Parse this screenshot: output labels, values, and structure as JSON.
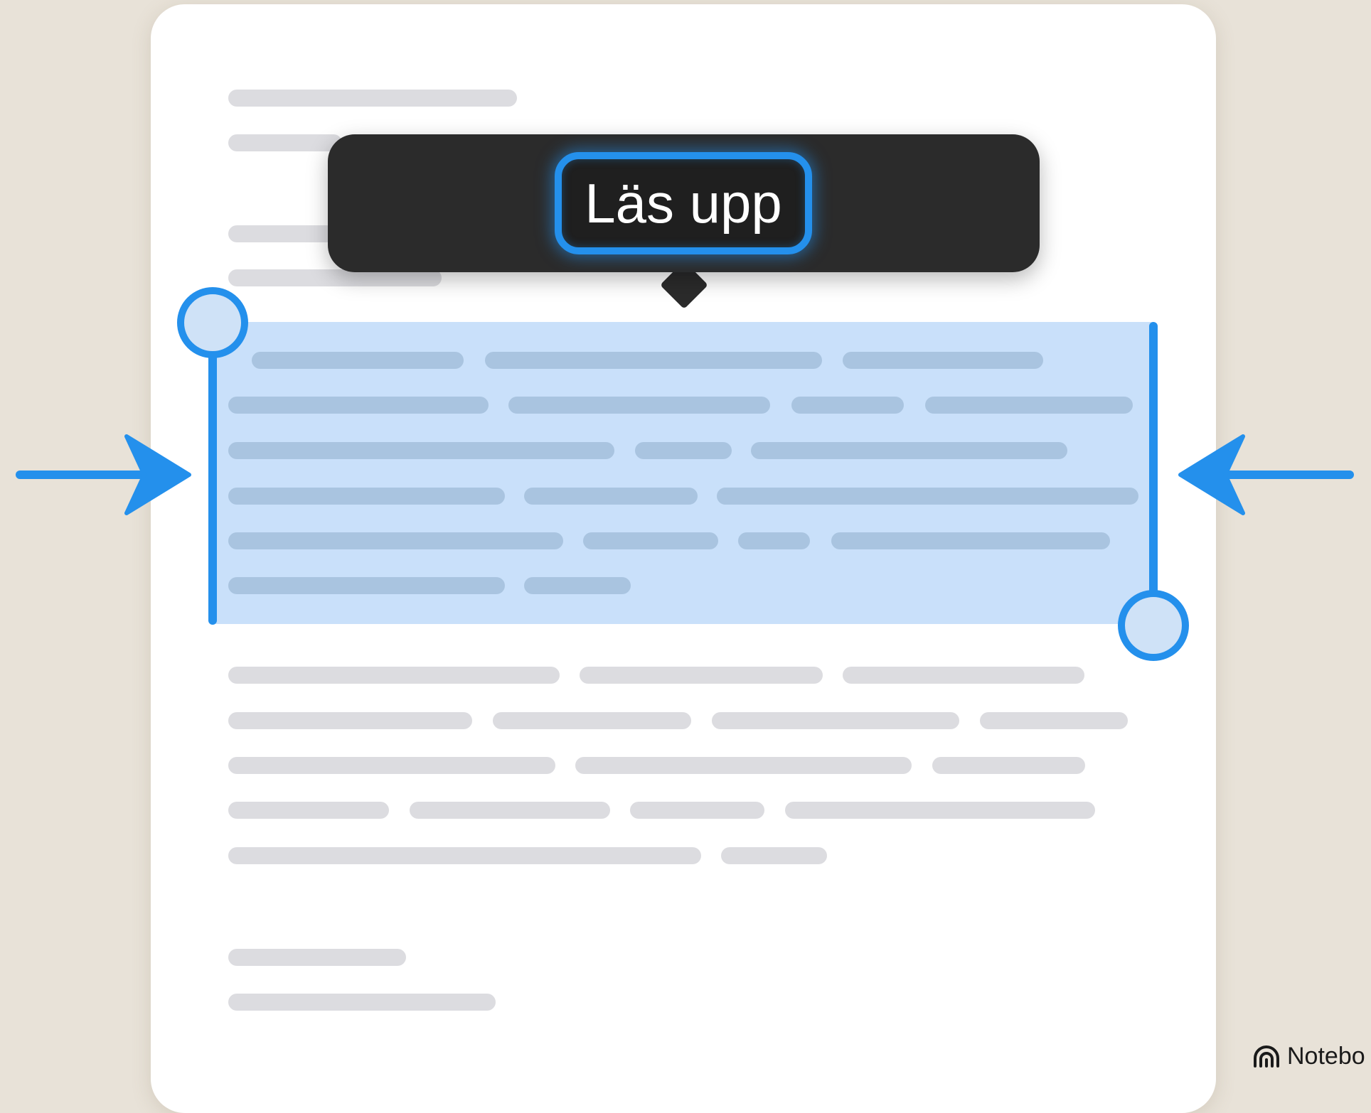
{
  "popup": {
    "action_label": "Läs upp"
  },
  "branding": {
    "text": "Notebo",
    "icon": "notebook-logo-icon"
  },
  "icons": {
    "left_arrow": "arrow-right-icon",
    "right_arrow": "arrow-left-icon"
  },
  "colors": {
    "accent": "#2490ec",
    "selection": "#c9e0fa",
    "popup": "#2b2b2b",
    "background": "#e8e2d8",
    "placeholder_text": "#dcdce0"
  }
}
